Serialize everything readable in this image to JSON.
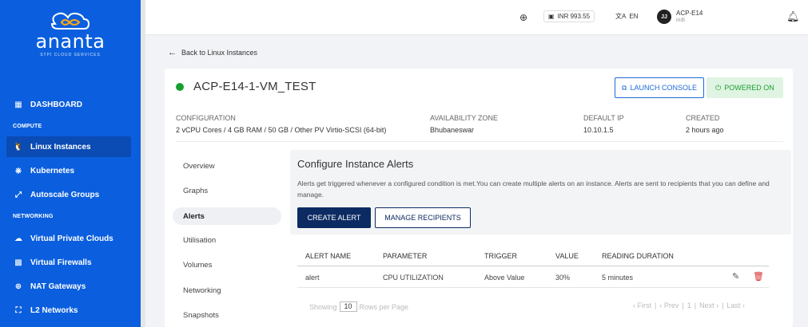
{
  "sidebar": {
    "logo": {
      "name": "ananta",
      "tagline": "STPI CLOUD SERVICES"
    },
    "dashboard_label": "DASHBOARD",
    "sections": {
      "compute": "COMPUTE",
      "networking": "NETWORKING"
    },
    "items": [
      {
        "label": "Linux Instances",
        "icon": "linux-icon",
        "active": true
      },
      {
        "label": "Kubernetes",
        "icon": "kubernetes-icon"
      },
      {
        "label": "Autoscale Groups",
        "icon": "autoscale-icon"
      },
      {
        "label": "Virtual Private Clouds",
        "icon": "cloud-icon"
      },
      {
        "label": "Virtual Firewalls",
        "icon": "firewall-icon"
      },
      {
        "label": "NAT Gateways",
        "icon": "globe-icon"
      },
      {
        "label": "L2 Networks",
        "icon": "network-icon"
      }
    ],
    "colors": {
      "background": "#0b5fde",
      "active": "#0a4bb4"
    }
  },
  "topbar": {
    "balance": "INR 993.55",
    "language": "EN",
    "user": {
      "initials": "JJ",
      "name": "ACP-E14",
      "sub": "indi"
    }
  },
  "back_link": "Back to Linux Instances",
  "instance": {
    "name": "ACP-E14-1-VM_TEST",
    "status_color": "#1a9e2f",
    "launch_console": "LAUNCH CONSOLE",
    "power_state": "POWERED ON",
    "info": {
      "configuration_label": "CONFIGURATION",
      "configuration_value": "2 vCPU Cores / 4 GB RAM / 50 GB / Other PV Virtio-SCSI (64-bit)",
      "zone_label": "AVAILABILITY ZONE",
      "zone_value": "Bhubaneswar",
      "ip_label": "DEFAULT IP",
      "ip_value": "10.10.1.5",
      "created_label": "CREATED",
      "created_value": "2 hours ago"
    }
  },
  "tabs": [
    {
      "label": "Overview"
    },
    {
      "label": "Graphs"
    },
    {
      "label": "Alerts",
      "active": true
    },
    {
      "label": "Utilisation"
    },
    {
      "label": "Volumes"
    },
    {
      "label": "Networking"
    },
    {
      "label": "Snapshots"
    }
  ],
  "alerts": {
    "title": "Configure Instance Alerts",
    "description": "Alerts get triggered whenever a configured condition is met.You can create multiple alerts on an instance. Alerts are sent to recipients that you can define and manage.",
    "create_button": "CREATE ALERT",
    "manage_button": "MANAGE RECIPIENTS",
    "columns": [
      "ALERT NAME",
      "PARAMETER",
      "TRIGGER",
      "VALUE",
      "READING DURATION"
    ],
    "rows": [
      {
        "name": "alert",
        "parameter": "CPU UTILIZATION",
        "trigger": "Above Value",
        "value": "30%",
        "duration": "5 minutes"
      }
    ],
    "pager": {
      "showing": "Showing",
      "rows_per_page_value": "10",
      "rows_per_page": "Rows per Page",
      "first": "‹ First",
      "prev": "‹ Prev",
      "page": "1",
      "next": "Next ›",
      "last": "Last ›"
    }
  }
}
